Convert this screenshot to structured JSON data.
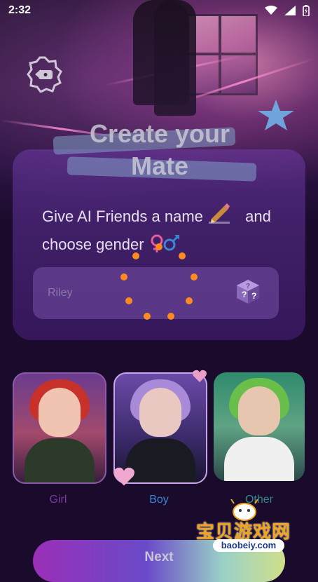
{
  "status_bar": {
    "time": "2:32",
    "icons": [
      "wifi-icon",
      "signal-icon",
      "battery-icon"
    ]
  },
  "header": {
    "back_icon": "back-arrow-icon",
    "title_line1": "Create your",
    "title_line2": "Mate"
  },
  "form": {
    "prompt_part1": "Give AI Friends a name",
    "prompt_part2": "and",
    "prompt_part3": "choose gender",
    "prompt_icons": [
      "pencil-icon",
      "gender-symbols-icon"
    ],
    "name_placeholder": "Riley",
    "name_value": "",
    "random_icon": "mystery-dice-icon"
  },
  "loading": {
    "visible": true,
    "color": "#ff8a1e"
  },
  "genders": [
    {
      "label": "Girl",
      "color": "#7a3aa0",
      "selected": false
    },
    {
      "label": "Boy",
      "color": "#3a86d6",
      "selected": true
    },
    {
      "label": "Other",
      "color": "#2e8b8a",
      "selected": false
    }
  ],
  "next_button": {
    "label": "Next"
  },
  "watermark": {
    "text": "宝贝游戏网",
    "url": "baobeiy.com"
  },
  "colors": {
    "background": "#1a0b2c",
    "panel": "#5a2f8a",
    "accent_orange": "#ff8a1e"
  }
}
